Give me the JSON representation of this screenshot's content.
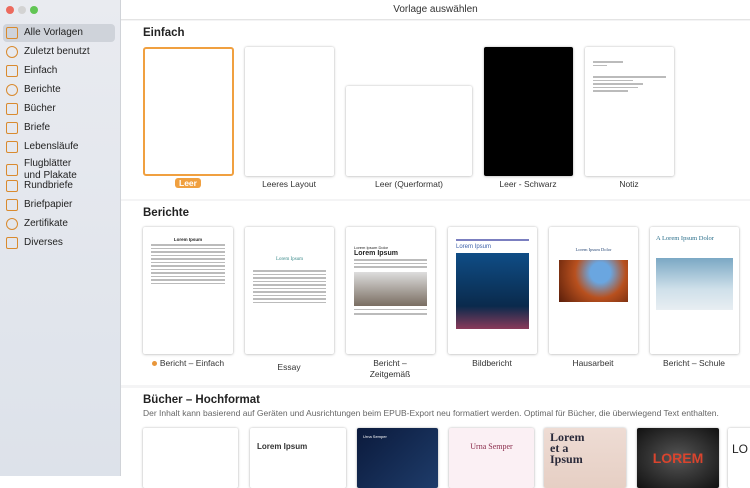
{
  "window": {
    "title": "Vorlage auswählen",
    "controls": {
      "close": "#ec6a5e",
      "minimize": "#d3d3d3",
      "zoom": "#61c554"
    }
  },
  "sidebar": {
    "items": [
      {
        "label": "Alle Vorlagen",
        "icon": "grid-icon",
        "selected": true
      },
      {
        "label": "Zuletzt benutzt",
        "icon": "clock-icon"
      },
      {
        "label": "Einfach",
        "icon": "document-icon"
      },
      {
        "label": "Berichte",
        "icon": "graduation-cap-icon"
      },
      {
        "label": "Bücher",
        "icon": "book-icon"
      },
      {
        "label": "Briefe",
        "icon": "letter-icon"
      },
      {
        "label": "Lebensläufe",
        "icon": "resume-icon"
      },
      {
        "label": "Flugblätter\nund Plakate",
        "icon": "flyer-icon"
      },
      {
        "label": "Rundbriefe",
        "icon": "newsletter-icon"
      },
      {
        "label": "Briefpapier",
        "icon": "stamp-icon"
      },
      {
        "label": "Zertifikate",
        "icon": "ribbon-icon"
      },
      {
        "label": "Diverses",
        "icon": "box-icon"
      }
    ]
  },
  "sections": {
    "einfach": {
      "title": "Einfach",
      "templates": [
        "Leer",
        "Leeres Layout",
        "Leer (Querformat)",
        "Leer - Schwarz",
        "Notiz"
      ]
    },
    "berichte": {
      "title": "Berichte",
      "templates": [
        "Bericht – Einfach",
        "Essay",
        "Bericht –\nZeitgemäß",
        "Bildbericht",
        "Hausarbeit",
        "Bericht – Schule"
      ],
      "previews": {
        "einfach": "Lorem Ipsum",
        "essay": "Lorem Ipsum",
        "zeitgemaess_sub": "Lorem Ipsum Dolor",
        "zeitgemaess": "Lorem Ipsum",
        "bild": "Lorem Ipsum",
        "haus": "Lorem Ipsum Dolor",
        "schule": "A Lorem Ipsum Dolor"
      }
    },
    "buecher": {
      "title": "Bücher – Hochformat",
      "description": "Der Inhalt kann basierend auf Geräten und Ausrichtungen beim EPUB-Export neu formatiert werden. Optimal für Bücher, die überwiegend Text enthalten.",
      "previews": [
        "Lorem Ipsum",
        "Urna Semper",
        "Urna Semper",
        "Lorem et a Ipsum",
        "LOREM",
        "LO"
      ]
    }
  },
  "accent": "#f0a040"
}
